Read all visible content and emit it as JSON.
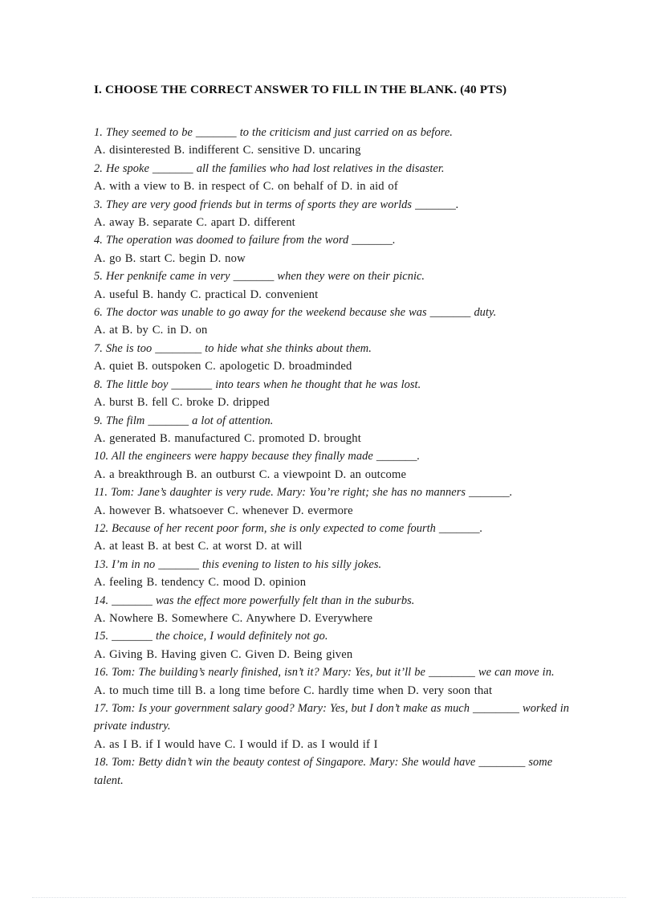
{
  "document": {
    "section_title": "I. CHOOSE THE CORRECT ANSWER TO FILL IN THE BLANK. (40 PTS)",
    "blank_short": "_______",
    "blank_long": "________",
    "text_color": "#1a1a1a",
    "page_background": "#ffffff",
    "footer_rule_color": "#d8dde4"
  },
  "questions": [
    {
      "number": "1.",
      "prompt": "1. They seemed to be _______ to the criticism and just carried on as before.",
      "options": "A. disinterested  B. indifferent  C. sensitive  D. uncaring"
    },
    {
      "number": "2.",
      "prompt": "2. He spoke _______ all the families who had lost relatives in the disaster.",
      "options": "A. with a view to B. in respect of C. on behalf of D. in aid of"
    },
    {
      "number": "3.",
      "prompt": "3. They are very good friends but in terms of sports they are worlds _______.",
      "options": "A. away B. separate  C. apart D. different"
    },
    {
      "number": "4.",
      "prompt": "4. The operation was doomed to failure from the word _______.",
      "options": "A. go B. start C. begin D. now"
    },
    {
      "number": "5.",
      "prompt": "5. Her penknife came in very _______ when they were on their picnic.",
      "options": "A. useful  B. handy C. practical D. convenient"
    },
    {
      "number": "6.",
      "prompt": "6. The doctor was unable to go away for the weekend because she was _______ duty.",
      "options": "A. at B. by C. in D. on"
    },
    {
      "number": "7.",
      "prompt": "7. She is too ________ to hide what she thinks about them.",
      "options": "A. quiet  B. outspoken  C. apologetic  D. broadminded"
    },
    {
      "number": "8.",
      "prompt": "8. The little boy _______ into tears when he thought that he was lost.",
      "options": "A. burst  B. fell C. broke D. dripped"
    },
    {
      "number": "9.",
      "prompt": "9. The film _______ a lot of attention.",
      "options": "A. generated  B. manufactured  C. promoted  D. brought"
    },
    {
      "number": "10.",
      "prompt": "10. All the engineers were happy because they finally made _______.",
      "options": "A. a breakthrough  B. an outburst  C. a viewpoint  D. an outcome"
    },
    {
      "number": "11.",
      "prompt": "11. Tom: Jane’s daughter is very rude. Mary: You’re right; she has no manners _______.",
      "options": "A. however  B. whatsoever  C. whenever  D. evermore"
    },
    {
      "number": "12.",
      "prompt": "12. Because of her recent poor form, she is only expected to come fourth _______.",
      "options": "A. at least B. at best C. at worst  D. at will"
    },
    {
      "number": "13.",
      "prompt": "13. I’m in no _______ this evening to listen to his silly jokes.",
      "options": "A. feeling  B. tendency  C. mood D. opinion"
    },
    {
      "number": "14.",
      "prompt": "14. _______ was the effect more powerfully felt than in the suburbs.",
      "options": "A. Nowhere  B. Somewhere  C. Anywhere  D. Everywhere"
    },
    {
      "number": "15.",
      "prompt": "15. _______ the choice, I would definitely not go.",
      "options": "A. Giving B. Having given  C. Given  D. Being given"
    },
    {
      "number": "16.",
      "prompt": "16. Tom: The building’s nearly finished, isn’t it? Mary: Yes, but it’ll be ________ we can move in.",
      "options": "A. to much time till B. a long time before C. hardly time when D. very soon that"
    },
    {
      "number": "17.",
      "prompt": "17. Tom: Is your government salary good? Mary: Yes, but I don’t make as much ________ worked in private industry.",
      "options": "A. as I B. if I would have C. I would if D. as I would if I"
    },
    {
      "number": "18.",
      "prompt": "18. Tom: Betty didn’t win the beauty contest of Singapore. Mary: She would have ________ some talent.",
      "options": ""
    }
  ]
}
